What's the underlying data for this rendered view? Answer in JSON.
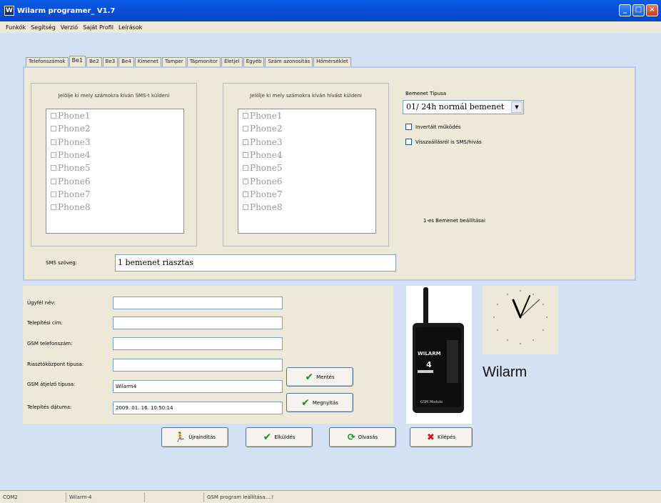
{
  "window": {
    "title": "Wilarm programer_ V1.7",
    "icon_letter": "W",
    "buttons": [
      "minimize-icon",
      "maximize-icon",
      "close-icon"
    ]
  },
  "menu": [
    "Funkók",
    "Segítség",
    "Verzió",
    "Saját Profil",
    "Leírások"
  ],
  "tabs": [
    "Telefonszámok",
    "Be1",
    "Be2",
    "Be3",
    "Be4",
    "Kimenet",
    "Tamper",
    "Tápmonitor",
    "Életjel",
    "Egyéb",
    "Szám azonosítás",
    "Hőmérséklet"
  ],
  "active_tab": "Be1",
  "sms_group": {
    "title": "Jelölje ki mely számokra kíván SMS-t küldeni",
    "phones": [
      "Phone1",
      "Phone2",
      "Phone3",
      "Phone4",
      "Phone5",
      "Phone6",
      "Phone7",
      "Phone8"
    ]
  },
  "call_group": {
    "title": "Jelölje ki mely számokra kíván hívást küldeni",
    "phones": [
      "Phone1",
      "Phone2",
      "Phone3",
      "Phone4",
      "Phone5",
      "Phone6",
      "Phone7",
      "Phone8"
    ]
  },
  "input_type": {
    "label": "Bemenet Típusa",
    "value": "01/ 24h normál bemenet",
    "inverted_label": "Invertált működés",
    "restore_label": "Visszaállásról is SMS/hívás",
    "settings_caption": "1-es Bemenet beállításai"
  },
  "sms_text": {
    "label": "SMS szöveg:",
    "value": "1 bemenet riasztas"
  },
  "client": {
    "fields": [
      {
        "label": "Ügyfél név:",
        "value": ""
      },
      {
        "label": "Telepítési cím:",
        "value": ""
      },
      {
        "label": "GSM telefonszám:",
        "value": ""
      },
      {
        "label": "Riasztóközpont típusa:",
        "value": ""
      },
      {
        "label": "GSM átjelző típusa:",
        "value": "Wilarm4"
      },
      {
        "label": "Telepítés dátuma:",
        "value": "2009. 01. 16. 10:50:14"
      }
    ],
    "save_button": "Mentés",
    "open_button": "Megnyitás"
  },
  "device": {
    "brand": "WILARM",
    "model": "4",
    "caption": "GSM Module"
  },
  "brand_text": "Wilarm",
  "bottom_buttons": {
    "restart": "Újraindítás",
    "send": "Elküldés",
    "read": "Olvasás",
    "exit": "Kilépés"
  },
  "status": {
    "port": "COM2",
    "device": "Wilarm-4",
    "empty": "",
    "message": "GSM program leállítása....!"
  },
  "colors": {
    "titlebar": "#0a4fd8",
    "panel": "#ece9d8",
    "background": "#d4e1f5",
    "accent_green": "#1e8a2a",
    "accent_red": "#d0181e"
  }
}
